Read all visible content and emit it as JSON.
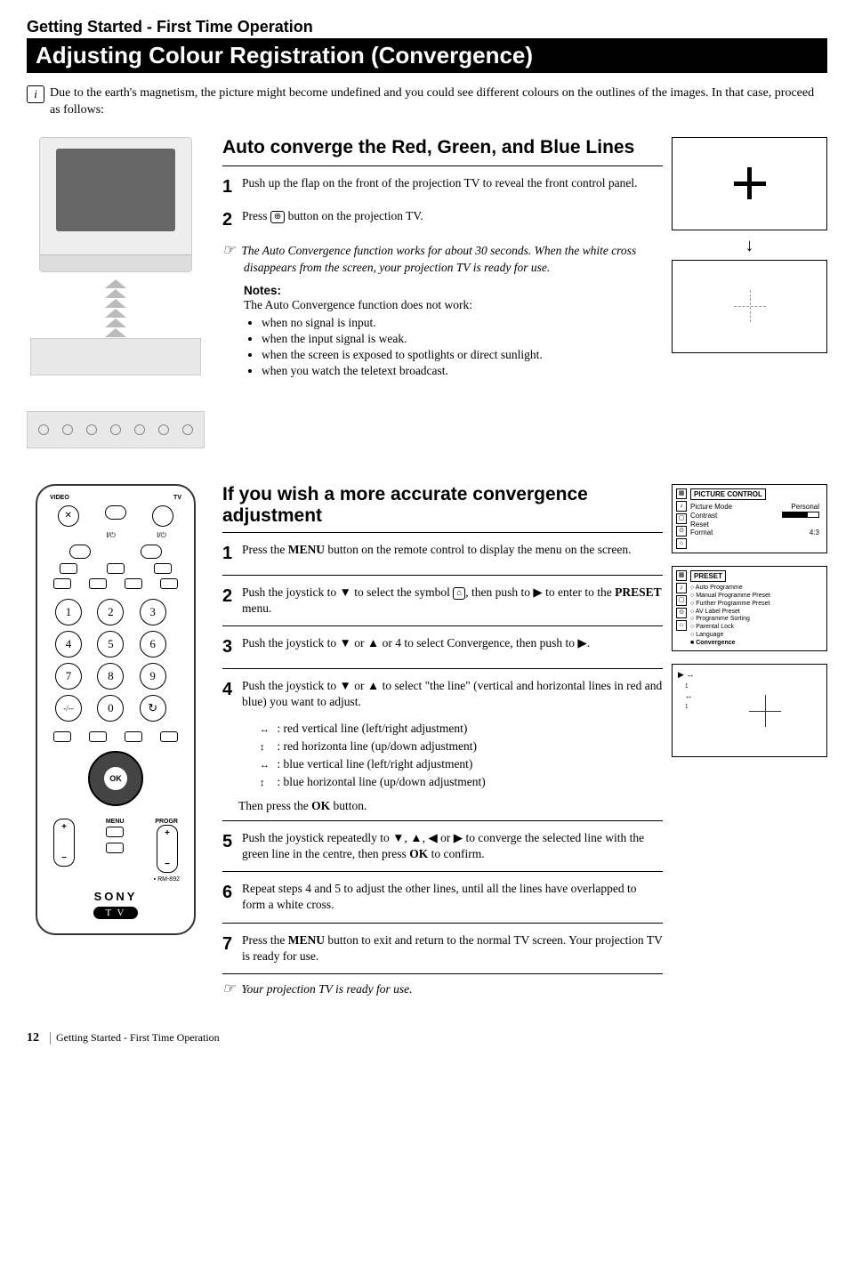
{
  "header": {
    "breadcrumb": "Getting Started - First Time Operation",
    "title": "Adjusting Colour Registration (Convergence)"
  },
  "info": {
    "text": "Due to the earth's magnetism, the picture might become undefined and you could see different colours on the outlines of the images. In that case, proceed as follows:"
  },
  "section1": {
    "title": "Auto converge the Red, Green, and Blue Lines",
    "step1": "Push up the flap on the front of the projection TV to reveal the front control panel.",
    "step2a": "Press ",
    "step2b": " button on the projection TV.",
    "convergeBtn": "⊕",
    "hint": "The Auto Convergence function works for about 30 seconds. When the white cross disappears from the screen, your projection TV is ready for use.",
    "notesLabel": "Notes:",
    "notesIntro": "The Auto Convergence function does not work:",
    "bullets": [
      "when no signal is input.",
      "when the input signal is weak.",
      "when the screen is exposed to spotlights or direct sunlight.",
      "when you watch the teletext broadcast."
    ]
  },
  "section2": {
    "title": "If you wish a more accurate convergence adjustment",
    "step1a": "Press the ",
    "menuWord": "MENU",
    "step1b": " button on the remote control to display the menu on the screen.",
    "step2a": "Push the joystick to ▼ to select the symbol ",
    "presetIcon": "⌂",
    "step2b": ", then push to ▶ to enter to the ",
    "presetWord": "PRESET",
    "step2c": " menu.",
    "step3": "Push the joystick to ▼ or ▲ or 4 to select Convergence, then push to ▶.",
    "step4a": "Push the joystick to ▼ or ▲ to select \"the line\" (vertical and horizontal lines in red and blue) you want to adjust.",
    "sub": [
      ": red vertical line (left/right adjustment)",
      ": red horizonta line (up/down adjustment)",
      ": blue vertical line (left/right adjustment)",
      ": blue horizontal line (up/down adjustment)"
    ],
    "subSym": [
      "↔",
      "↕",
      "↔",
      "↕"
    ],
    "then": "Then press the ",
    "okWord": "OK",
    "thenEnd": " button.",
    "step5a": "Push the joystick repeatedly to ▼, ▲, ◀ or ▶ to converge the selected line with the green line in the centre, then press ",
    "step5b": " to confirm.",
    "step6": "Repeat steps 4 and 5 to adjust the other lines, until all the lines have overlapped to form a white cross.",
    "step7a": "Press the ",
    "step7b": " button to exit and return to the normal TV screen. Your projection TV is ready for use.",
    "finalHint": "Your projection TV is ready for use."
  },
  "osd1": {
    "title": "PICTURE  CONTROL",
    "rows": [
      {
        "l": "Picture Mode",
        "r": "Personal"
      },
      {
        "l": "Contrast",
        "r": ""
      },
      {
        "l": "Reset",
        "r": ""
      },
      {
        "l": "Format",
        "r": "4:3"
      }
    ]
  },
  "osd2": {
    "title": "PRESET",
    "items": [
      "Auto Programme",
      "Manual Programme Preset",
      "Further Programme Preset",
      "AV Label Preset",
      "Programme Sorting",
      "Parental Lock",
      "Language",
      "Convergence"
    ]
  },
  "remote": {
    "videoLabel": "VIDEO",
    "tvLabel": "TV",
    "power1": "I/⏻",
    "power2": "I/⏻",
    "keys": [
      "1",
      "2",
      "3",
      "4",
      "5",
      "6",
      "7",
      "8",
      "9",
      "-/--",
      "0",
      "↻"
    ],
    "ok": "OK",
    "progr": "PROGR",
    "menu": "MENU",
    "model": "RM-892",
    "brand": "SONY",
    "tvBadge": "T V"
  },
  "footer": {
    "page": "12",
    "text": "Getting Started - First Time Operation"
  }
}
